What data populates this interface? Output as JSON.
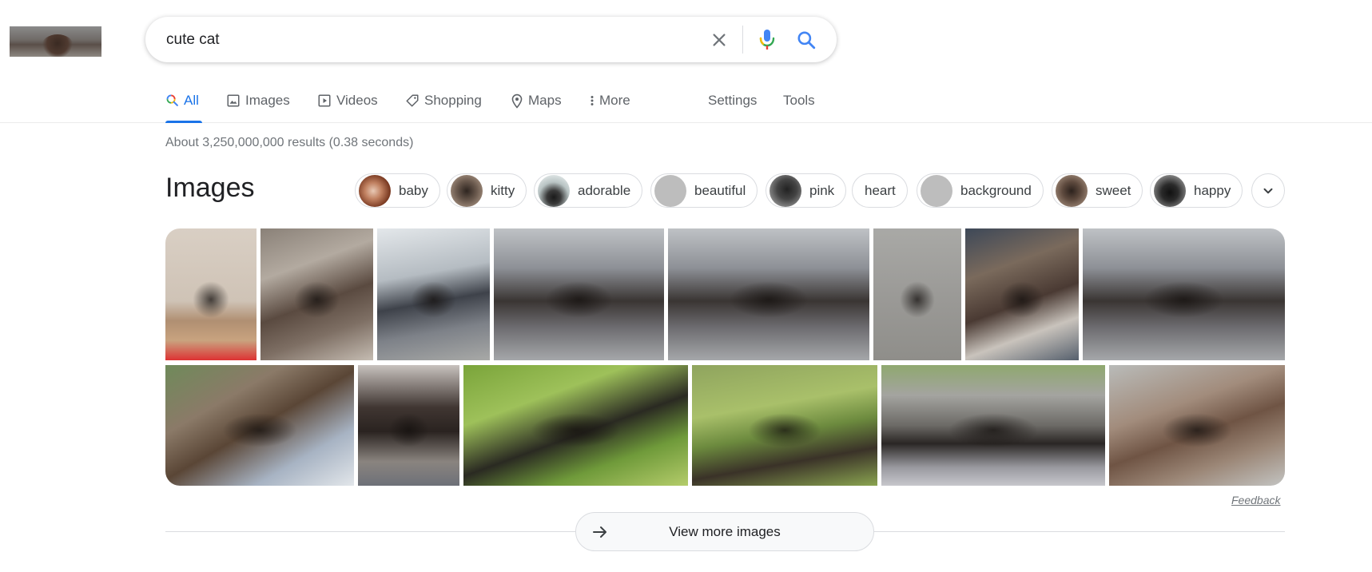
{
  "search": {
    "query": "cute cat"
  },
  "tabs": [
    {
      "label": "All",
      "icon": "search-icon",
      "active": true
    },
    {
      "label": "Images",
      "icon": "image-icon"
    },
    {
      "label": "Videos",
      "icon": "play-icon"
    },
    {
      "label": "Shopping",
      "icon": "tag-icon"
    },
    {
      "label": "Maps",
      "icon": "map-pin-icon"
    },
    {
      "label": "More",
      "icon": "more-vert-icon"
    }
  ],
  "tools": {
    "settings_label": "Settings",
    "tools_label": "Tools"
  },
  "results": {
    "stats": "About 3,250,000,000 results (0.38 seconds)"
  },
  "images_section": {
    "title": "Images",
    "chips": [
      {
        "label": "baby",
        "has_thumb": true
      },
      {
        "label": "kitty",
        "has_thumb": true
      },
      {
        "label": "adorable",
        "has_thumb": true
      },
      {
        "label": "beautiful",
        "has_thumb": true
      },
      {
        "label": "pink",
        "has_thumb": true
      },
      {
        "label": "heart",
        "has_thumb": false
      },
      {
        "label": "background",
        "has_thumb": true
      },
      {
        "label": "sweet",
        "has_thumb": true
      },
      {
        "label": "happy",
        "has_thumb": true
      }
    ],
    "feedback_label": "Feedback",
    "view_more_label": "View more images"
  },
  "colors": {
    "accent": "#1a73e8",
    "text_secondary": "#5f6368",
    "border": "#dadce0"
  }
}
